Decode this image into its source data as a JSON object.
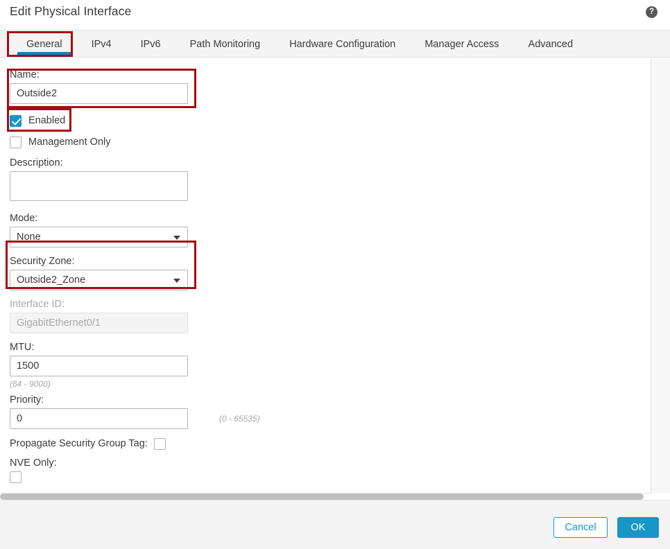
{
  "dialog": {
    "title": "Edit Physical Interface",
    "help_icon_glyph": "?",
    "help_icon_name": "help-icon"
  },
  "tabs": [
    {
      "label": "General",
      "active": true
    },
    {
      "label": "IPv4",
      "active": false
    },
    {
      "label": "IPv6",
      "active": false
    },
    {
      "label": "Path Monitoring",
      "active": false
    },
    {
      "label": "Hardware Configuration",
      "active": false
    },
    {
      "label": "Manager Access",
      "active": false
    },
    {
      "label": "Advanced",
      "active": false
    }
  ],
  "form": {
    "name": {
      "label": "Name:",
      "value": "Outside2",
      "placeholder": ""
    },
    "enabled": {
      "label": "Enabled",
      "checked": true
    },
    "management_only": {
      "label": "Management Only",
      "checked": false
    },
    "description": {
      "label": "Description:",
      "value": "",
      "placeholder": ""
    },
    "mode": {
      "label": "Mode:",
      "value": "None",
      "options": [
        "None"
      ]
    },
    "security_zone": {
      "label": "Security Zone:",
      "value": "Outside2_Zone",
      "options": [
        "Outside2_Zone"
      ]
    },
    "interface_id": {
      "label": "Interface ID:",
      "value": "GigabitEthernet0/1",
      "readonly": true
    },
    "mtu": {
      "label": "MTU:",
      "value": "1500",
      "hint": "(64 - 9000)"
    },
    "priority": {
      "label": "Priority:",
      "value": "0",
      "hint": "(0 - 65535)"
    },
    "propagate_sgt": {
      "label": "Propagate Security Group Tag:",
      "checked": false
    },
    "nve_only": {
      "label": "NVE Only:",
      "checked": false
    }
  },
  "footer": {
    "cancel_label": "Cancel",
    "ok_label": "OK"
  },
  "colors": {
    "accent_blue": "#1796c8",
    "tab_underline": "#1a7db5",
    "annotation_red": "#a30d13",
    "text": "#3c3c3e",
    "disabled_text": "#a9a9ad"
  }
}
